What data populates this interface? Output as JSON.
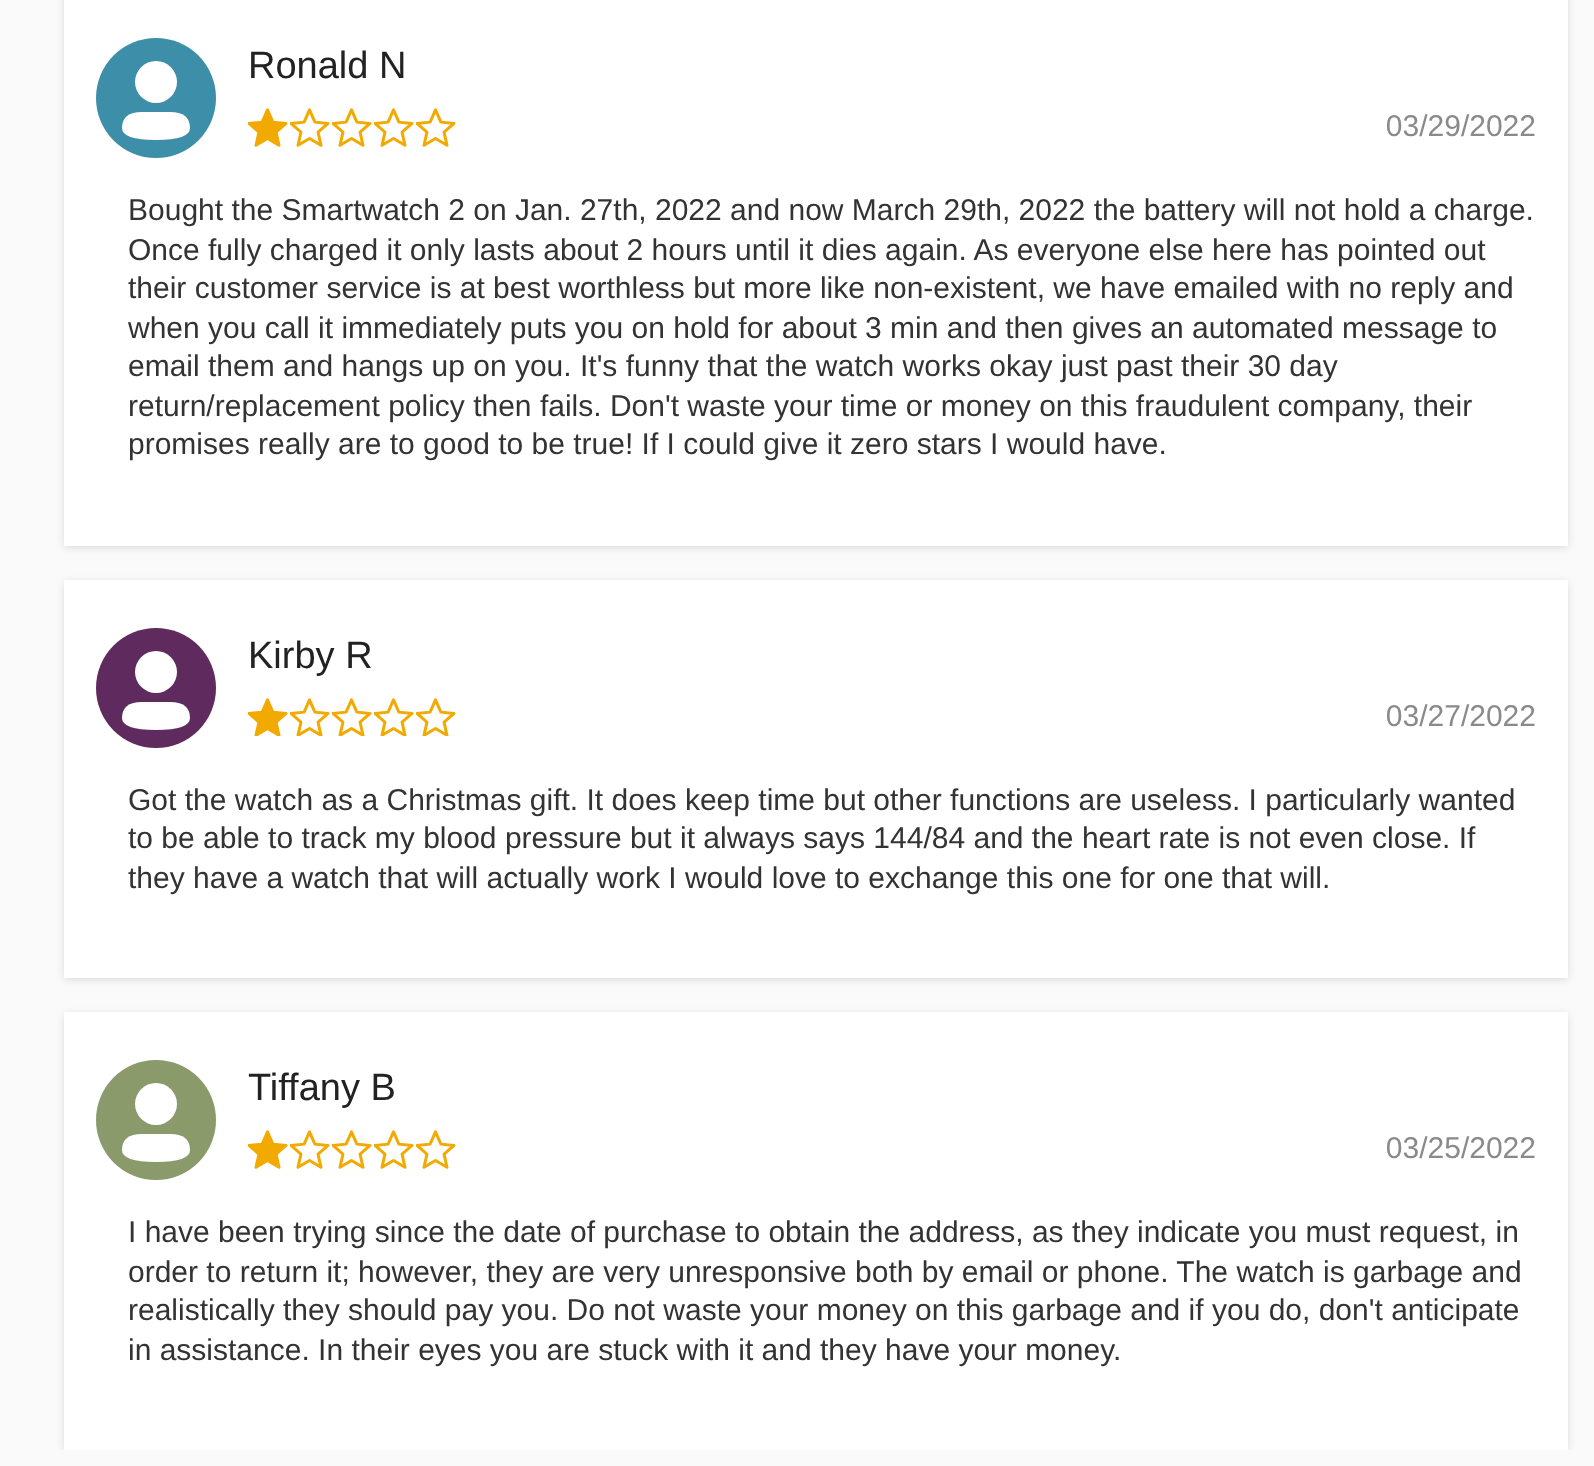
{
  "reviews": [
    {
      "name": "Ronald N",
      "color": "#3d8ea8",
      "stars": 1,
      "date": "03/29/2022",
      "text": "Bought the Smartwatch 2 on Jan. 27th, 2022 and now March 29th, 2022 the battery will not hold a charge. Once fully charged it only lasts about 2 hours until it dies again. As everyone else here has pointed out their customer service is at best worthless but more like non-existent, we have emailed with no reply and when you call it immediately puts you on hold for about 3 min and then gives an automated message to email them and hangs up on you. It's funny that the watch works okay just past their 30 day return/replacement policy then fails. Don't waste your time or money on this fraudulent company, their promises really are to good to be true! If I could give it zero stars I would have."
    },
    {
      "name": "Kirby R",
      "color": "#5f2b5e",
      "stars": 1,
      "date": "03/27/2022",
      "text": "Got the watch as a Christmas gift. It does keep time but other functions are useless. I particularly wanted to be able to track my blood pressure but it always says 144/84 and the heart rate is not even close. If they have a watch that will actually work I would love to exchange this one for one that will."
    },
    {
      "name": "Tiffany B",
      "color": "#8a9a6b",
      "stars": 1,
      "date": "03/25/2022",
      "text": "I have been trying since the date of purchase to obtain the address, as they indicate you must request, in order to return it; however, they are very unresponsive both by email or phone. The watch is garbage and realistically they should pay you. Do not waste your money on this garbage and if you do, don't anticipate in assistance. In their eyes you are stuck with it and they have your money."
    }
  ]
}
